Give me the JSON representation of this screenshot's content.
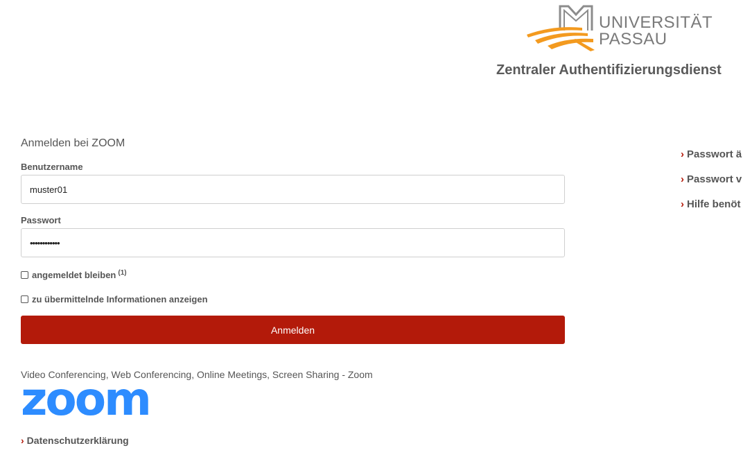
{
  "header": {
    "logo_line1": "UNIVERSITÄT",
    "logo_line2": "PASSAU",
    "service_title": "Zentraler Authentifizierungsdienst"
  },
  "form": {
    "title": "Anmelden bei ZOOM",
    "username_label": "Benutzername",
    "username_value": "muster01",
    "password_label": "Passwort",
    "password_value": "••••••••••••",
    "remember_label": "angemeldet bleiben",
    "remember_footnote": "(1)",
    "remember_checked": false,
    "show_info_label": "zu übermittelnde Informationen anzeigen",
    "show_info_checked": false,
    "submit_label": "Anmelden"
  },
  "service": {
    "description": "Video Conferencing, Web Conferencing, Online Meetings, Screen Sharing - Zoom",
    "logo_text": "zoom"
  },
  "footer": {
    "arrow": "›",
    "privacy_link": "Datenschutzerklärung"
  },
  "sidebar": {
    "links": [
      "Passwort ä",
      "Passwort v",
      "Hilfe benöt"
    ]
  },
  "colors": {
    "accent_red": "#b31a0a",
    "logo_orange": "#f39a1f",
    "zoom_blue": "#2d8cff",
    "text_gray": "#555555"
  }
}
